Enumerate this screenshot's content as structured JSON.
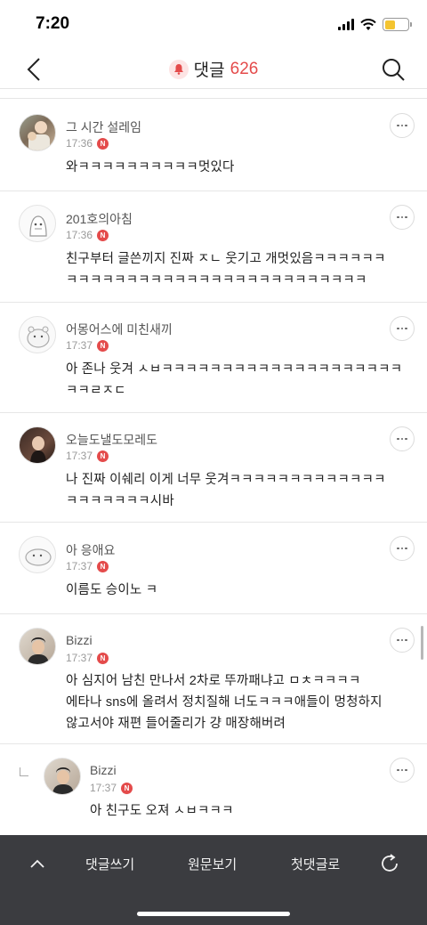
{
  "status": {
    "time": "7:20"
  },
  "nav": {
    "title": "댓글",
    "count": "626"
  },
  "comments": [
    {
      "name": "그 시간 설레임",
      "time": "17:36",
      "text": "와ㅋㅋㅋㅋㅋㅋㅋㅋㅋㅋ멋있다"
    },
    {
      "name": "201호의아침",
      "time": "17:36",
      "text": "친구부터 글쓴끼지 진짜 ㅈㄴ 웃기고 개멋있음ㅋㅋㅋㅋㅋㅋ\nㅋㅋㅋㅋㅋㅋㅋㅋㅋㅋㅋㅋㅋㅋㅋㅋㅋㅋㅋㅋㅋㅋㅋㅋㅋ"
    },
    {
      "name": "어몽어스에 미친새끼",
      "time": "17:37",
      "text": "아 존나 웃겨 ㅅㅂㅋㅋㅋㅋㅋㅋㅋㅋㅋㅋㅋㅋㅋㅋㅋㅋㅋㅋㅋㅋ\nㅋㅋㄹㅈㄷ"
    },
    {
      "name": "오늘도낼도모레도",
      "time": "17:37",
      "text": "나 진짜 이쉐리 이게 너무 웃겨ㅋㅋㅋㅋㅋㅋㅋㅋㅋㅋㅋㅋㅋ\nㅋㅋㅋㅋㅋㅋㅋ시바"
    },
    {
      "name": "아 응애요",
      "time": "17:37",
      "text": "이름도 승이노 ㅋ"
    },
    {
      "name": "Bizzi",
      "time": "17:37",
      "text": "아 심지어 남친 만나서 2차로 뚜까패냐고 ㅁㅊㅋㅋㅋㅋ\n에타나 sns에 올려서 정치질해 너도ㅋㅋㅋ애들이 멍청하지\n않고서야 재편 들어줄리가 걍 매장해버려"
    },
    {
      "name": "Bizzi",
      "time": "17:37",
      "text": "아 친구도 오져 ㅅㅂㅋㅋㅋ"
    }
  ],
  "badge": "N",
  "bottom": {
    "write": "댓글쓰기",
    "original": "원문보기",
    "first": "첫댓글로"
  }
}
